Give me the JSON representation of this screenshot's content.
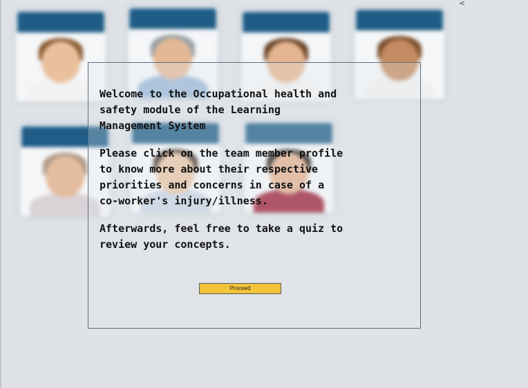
{
  "nav": {
    "back_glyph": "<"
  },
  "team_cards": [
    {
      "label": "",
      "hair": "#8a5a32",
      "skin": "#e9c09e",
      "shirt": "#f2f2f2"
    },
    {
      "label": "",
      "hair": "#9aa0a4",
      "skin": "#e3b896",
      "shirt": "#9bb7d8"
    },
    {
      "label": "",
      "hair": "#6a4225",
      "skin": "#e4b590",
      "shirt": "#f0f0f0"
    },
    {
      "label": "",
      "hair": "#7a4e2c",
      "skin": "#c58b62",
      "shirt": "#f0f0f0"
    },
    {
      "label": "",
      "hair": "#b09a88",
      "skin": "#e4bda0",
      "shirt": "#d9d2d6"
    },
    {
      "label": "",
      "hair": "#3b2a20",
      "skin": "#e8c4a4",
      "shirt": "#c9d3e4"
    },
    {
      "label": "",
      "hair": "#1e1412",
      "skin": "#e2b08e",
      "shirt": "#9c1d35"
    }
  ],
  "welcome": {
    "intro": "Welcome to the Occupational health and safety module of the Learning Management System",
    "instruction": "Please click on the team member profile to know more about their respective priorities and concerns in case of a co-worker's injury/illness.",
    "afterwards": "Afterwards, feel free to take a quiz to review your concepts.",
    "proceed_label": "Proceed"
  },
  "colors": {
    "card_header": "#1f5c86",
    "proceed_button": "#f3c43a",
    "overlay_border": "#5a6b7e",
    "background": "#dfe2e6"
  }
}
